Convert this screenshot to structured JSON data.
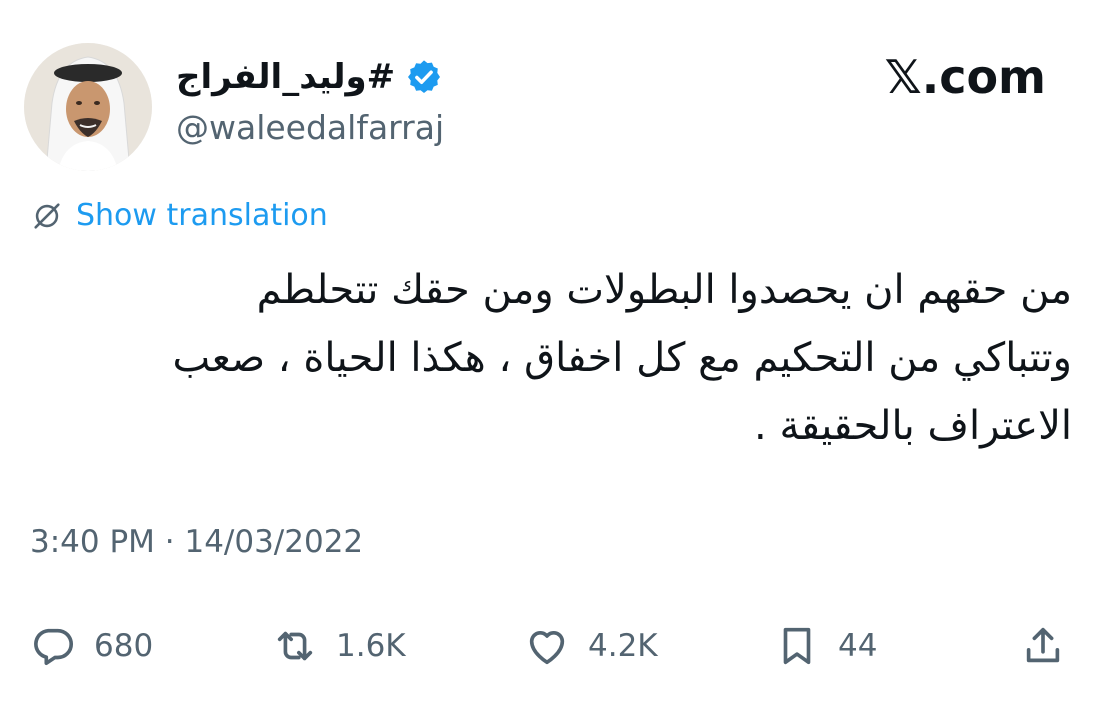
{
  "profile": {
    "display_name": "#وليد_الفراج",
    "handle": "@waleedalfarraj",
    "verified": true,
    "avatar_icon": "profile-photo"
  },
  "site": {
    "logo": "𝕏.com"
  },
  "tweet": {
    "translate_label": "Show translation",
    "lines": [
      "من حقهم ان يحصدوا البطولات ومن حقك تتحلطم",
      "وتتباكي من التحكيم مع كل اخفاق ، هكذا الحياة ، صعب",
      "الاعتراف بالحقيقة ."
    ],
    "timestamp": "3:40 PM · 14/03/2022"
  },
  "actions": {
    "replies": "680",
    "reposts": "1.6K",
    "likes": "4.2K",
    "bookmarks": "44"
  },
  "colors": {
    "accent": "#1d9bf0",
    "text": "#0f1419",
    "muted": "#536471"
  }
}
